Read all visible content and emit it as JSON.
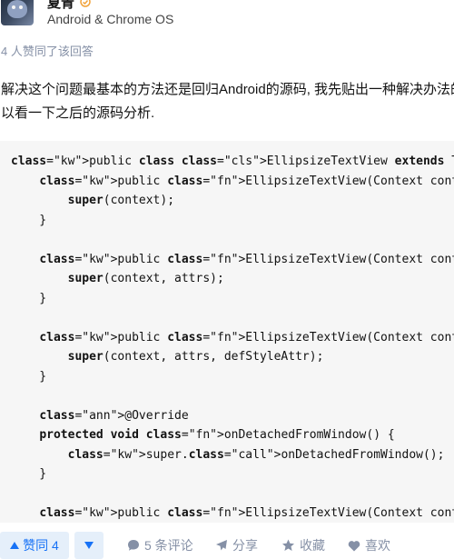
{
  "author": {
    "name": "夏青",
    "headline": "Android & Chrome OS"
  },
  "voters_note": "4 人赞同了该回答",
  "paragraph": {
    "line1": "解决这个问题最基本的方法还是回归Android的源码, 我先贴出一种解决办法的",
    "line2": "以看一下之后的源码分析."
  },
  "code": {
    "language": "java",
    "lines": [
      "public class EllipsizeTextView extends TextView {",
      "    public EllipsizeTextView(Context context) {",
      "        super(context);",
      "    }",
      "",
      "    public EllipsizeTextView(Context context, AttributeSet attrs) {",
      "        super(context, attrs);",
      "    }",
      "",
      "    public EllipsizeTextView(Context context, AttributeSet attrs, int defStyleAttr) {",
      "        super(context, attrs, defStyleAttr);",
      "    }",
      "",
      "    @Override",
      "    protected void onDetachedFromWindow() {",
      "        super.onDetachedFromWindow();",
      "    }",
      "",
      "    public EllipsizeTextView(Context context, AttributeSet attrs, int defStyleAttr, int defStyleRes) {"
    ]
  },
  "actions": {
    "upvote_label": "赞同 4",
    "comments_label": "5 条评论",
    "share_label": "分享",
    "collect_label": "收藏",
    "like_label": "喜欢"
  },
  "colors": {
    "accent": "#1772f6",
    "accent_bg": "#e5effa",
    "muted": "#8590a6",
    "code_bg": "#f6f6f6",
    "method_name": "#dd4a68",
    "class_name": "#175199",
    "method_call": "#1e7bc3"
  }
}
